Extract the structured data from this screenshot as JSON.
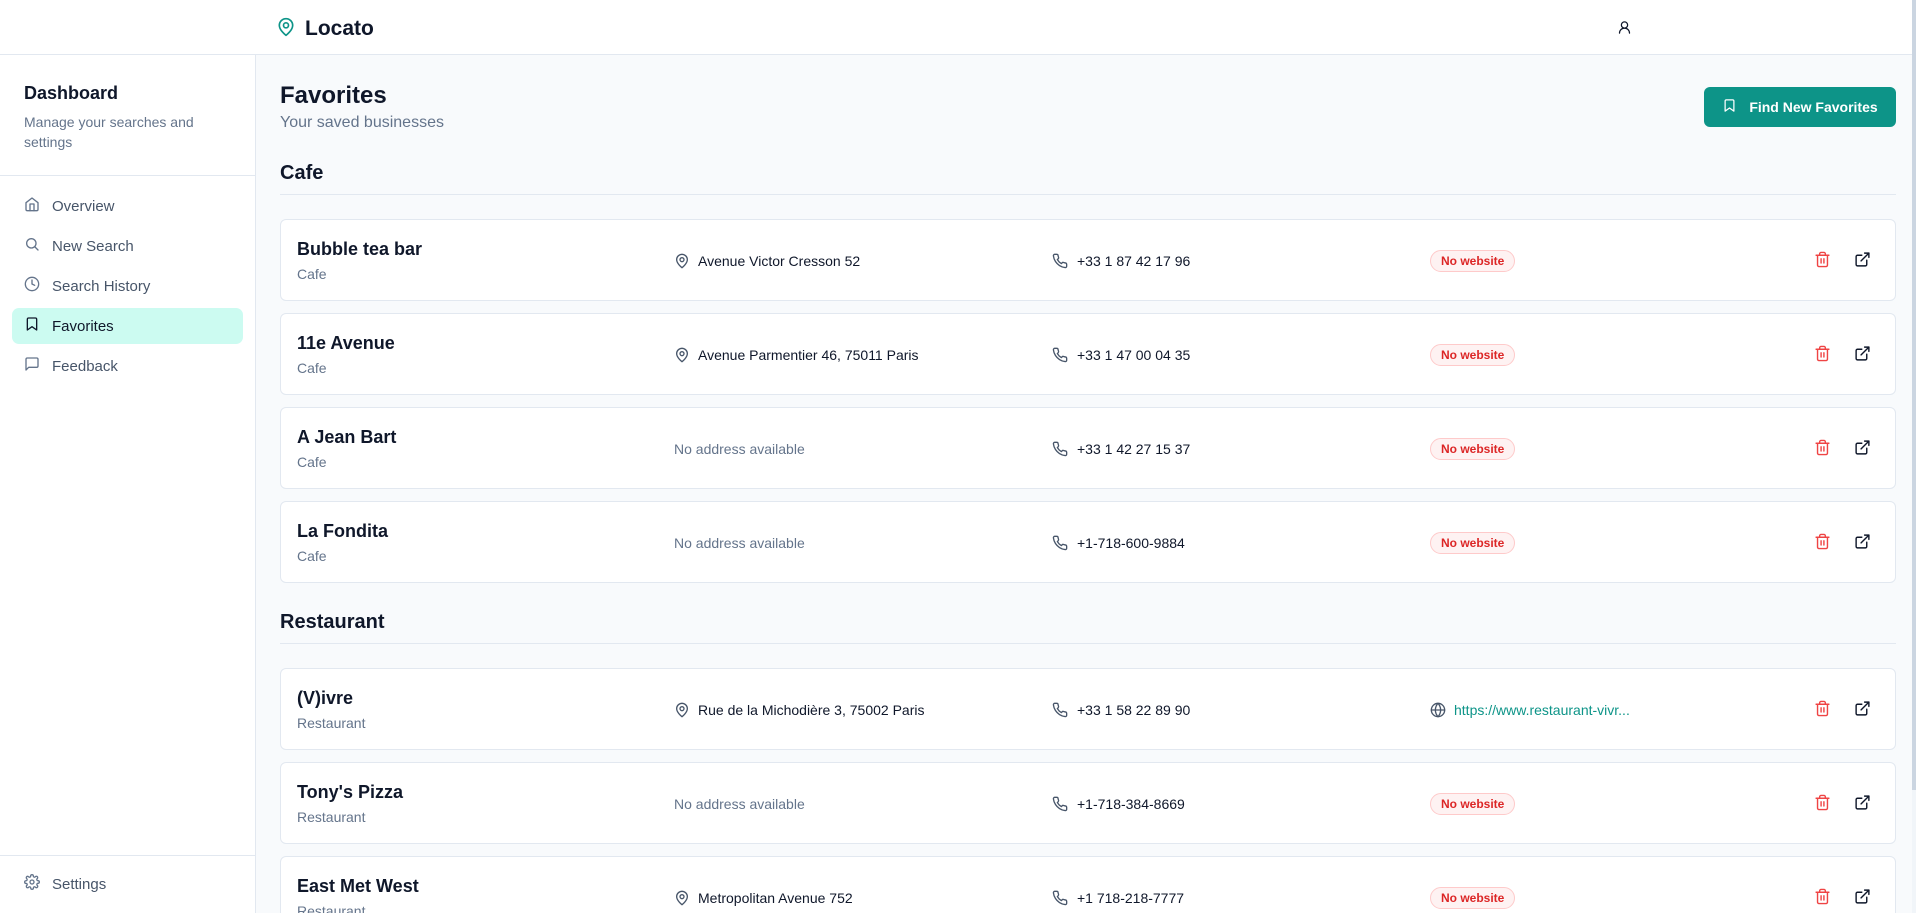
{
  "app": {
    "name": "Locato"
  },
  "sidebar": {
    "title": "Dashboard",
    "subtitle": "Manage your searches and settings",
    "items": [
      {
        "label": "Overview",
        "icon": "home-icon"
      },
      {
        "label": "New Search",
        "icon": "search-icon"
      },
      {
        "label": "Search History",
        "icon": "clock-icon"
      },
      {
        "label": "Favorites",
        "icon": "bookmark-icon",
        "active": true
      },
      {
        "label": "Feedback",
        "icon": "message-icon"
      }
    ],
    "settings_label": "Settings"
  },
  "page": {
    "title": "Favorites",
    "subtitle": "Your saved businesses",
    "cta_label": "Find New Favorites"
  },
  "sections": [
    {
      "title": "Cafe",
      "items": [
        {
          "name": "Bubble tea bar",
          "category": "Cafe",
          "address": "Avenue Victor Cresson 52",
          "phone": "+33 1 87 42 17 96",
          "website": null
        },
        {
          "name": "11e Avenue",
          "category": "Cafe",
          "address": "Avenue Parmentier 46, 75011 Paris",
          "phone": "+33 1 47 00 04 35",
          "website": null
        },
        {
          "name": "A Jean Bart",
          "category": "Cafe",
          "address": null,
          "phone": "+33 1 42 27 15 37",
          "website": null
        },
        {
          "name": "La Fondita",
          "category": "Cafe",
          "address": null,
          "phone": "+1-718-600-9884",
          "website": null
        }
      ]
    },
    {
      "title": "Restaurant",
      "items": [
        {
          "name": "(V)ivre",
          "category": "Restaurant",
          "address": "Rue de la Michodière 3, 75002 Paris",
          "phone": "+33 1 58 22 89 90",
          "website": "https://www.restaurant-vivr..."
        },
        {
          "name": "Tony's Pizza",
          "category": "Restaurant",
          "address": null,
          "phone": "+1-718-384-8669",
          "website": null
        },
        {
          "name": "East Met West",
          "category": "Restaurant",
          "address": "Metropolitan Avenue 752",
          "phone": "+1 718-218-7777",
          "website": null
        }
      ]
    }
  ],
  "labels": {
    "no_address": "No address available",
    "no_website": "No website"
  },
  "colors": {
    "accent": "#0d9488",
    "active_nav_bg": "#ccfbf1",
    "danger": "#dc2626"
  }
}
